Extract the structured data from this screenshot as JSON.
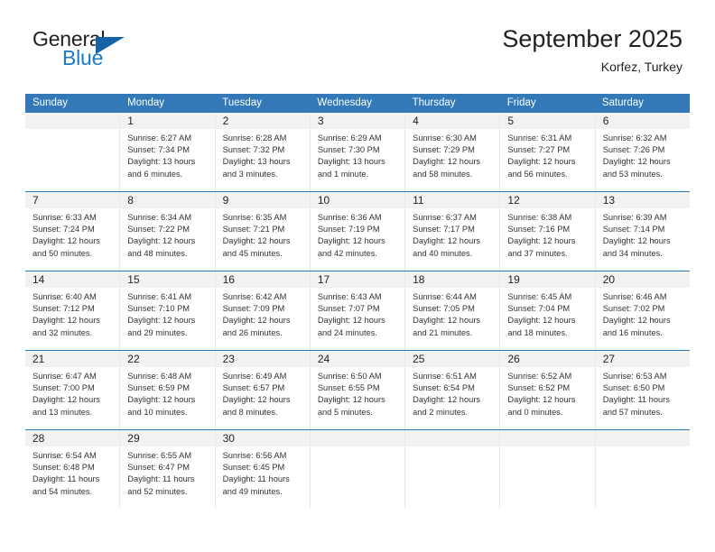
{
  "brand": {
    "name_top": "General",
    "name_bottom": "Blue",
    "accent_color": "#1464a5",
    "text_color": "#1a7ac4"
  },
  "header": {
    "month_title": "September 2025",
    "location": "Korfez, Turkey"
  },
  "calendar": {
    "header_bg": "#3379b8",
    "daynumber_bg": "#f2f2f2",
    "weekday_headers": [
      "Sunday",
      "Monday",
      "Tuesday",
      "Wednesday",
      "Thursday",
      "Friday",
      "Saturday"
    ],
    "weeks": [
      [
        {
          "empty": true,
          "day": "",
          "sunrise": "",
          "sunset": "",
          "daylight1": "",
          "daylight2": ""
        },
        {
          "empty": false,
          "day": "1",
          "sunrise": "Sunrise: 6:27 AM",
          "sunset": "Sunset: 7:34 PM",
          "daylight1": "Daylight: 13 hours",
          "daylight2": "and 6 minutes."
        },
        {
          "empty": false,
          "day": "2",
          "sunrise": "Sunrise: 6:28 AM",
          "sunset": "Sunset: 7:32 PM",
          "daylight1": "Daylight: 13 hours",
          "daylight2": "and 3 minutes."
        },
        {
          "empty": false,
          "day": "3",
          "sunrise": "Sunrise: 6:29 AM",
          "sunset": "Sunset: 7:30 PM",
          "daylight1": "Daylight: 13 hours",
          "daylight2": "and 1 minute."
        },
        {
          "empty": false,
          "day": "4",
          "sunrise": "Sunrise: 6:30 AM",
          "sunset": "Sunset: 7:29 PM",
          "daylight1": "Daylight: 12 hours",
          "daylight2": "and 58 minutes."
        },
        {
          "empty": false,
          "day": "5",
          "sunrise": "Sunrise: 6:31 AM",
          "sunset": "Sunset: 7:27 PM",
          "daylight1": "Daylight: 12 hours",
          "daylight2": "and 56 minutes."
        },
        {
          "empty": false,
          "day": "6",
          "sunrise": "Sunrise: 6:32 AM",
          "sunset": "Sunset: 7:26 PM",
          "daylight1": "Daylight: 12 hours",
          "daylight2": "and 53 minutes."
        }
      ],
      [
        {
          "empty": false,
          "day": "7",
          "sunrise": "Sunrise: 6:33 AM",
          "sunset": "Sunset: 7:24 PM",
          "daylight1": "Daylight: 12 hours",
          "daylight2": "and 50 minutes."
        },
        {
          "empty": false,
          "day": "8",
          "sunrise": "Sunrise: 6:34 AM",
          "sunset": "Sunset: 7:22 PM",
          "daylight1": "Daylight: 12 hours",
          "daylight2": "and 48 minutes."
        },
        {
          "empty": false,
          "day": "9",
          "sunrise": "Sunrise: 6:35 AM",
          "sunset": "Sunset: 7:21 PM",
          "daylight1": "Daylight: 12 hours",
          "daylight2": "and 45 minutes."
        },
        {
          "empty": false,
          "day": "10",
          "sunrise": "Sunrise: 6:36 AM",
          "sunset": "Sunset: 7:19 PM",
          "daylight1": "Daylight: 12 hours",
          "daylight2": "and 42 minutes."
        },
        {
          "empty": false,
          "day": "11",
          "sunrise": "Sunrise: 6:37 AM",
          "sunset": "Sunset: 7:17 PM",
          "daylight1": "Daylight: 12 hours",
          "daylight2": "and 40 minutes."
        },
        {
          "empty": false,
          "day": "12",
          "sunrise": "Sunrise: 6:38 AM",
          "sunset": "Sunset: 7:16 PM",
          "daylight1": "Daylight: 12 hours",
          "daylight2": "and 37 minutes."
        },
        {
          "empty": false,
          "day": "13",
          "sunrise": "Sunrise: 6:39 AM",
          "sunset": "Sunset: 7:14 PM",
          "daylight1": "Daylight: 12 hours",
          "daylight2": "and 34 minutes."
        }
      ],
      [
        {
          "empty": false,
          "day": "14",
          "sunrise": "Sunrise: 6:40 AM",
          "sunset": "Sunset: 7:12 PM",
          "daylight1": "Daylight: 12 hours",
          "daylight2": "and 32 minutes."
        },
        {
          "empty": false,
          "day": "15",
          "sunrise": "Sunrise: 6:41 AM",
          "sunset": "Sunset: 7:10 PM",
          "daylight1": "Daylight: 12 hours",
          "daylight2": "and 29 minutes."
        },
        {
          "empty": false,
          "day": "16",
          "sunrise": "Sunrise: 6:42 AM",
          "sunset": "Sunset: 7:09 PM",
          "daylight1": "Daylight: 12 hours",
          "daylight2": "and 26 minutes."
        },
        {
          "empty": false,
          "day": "17",
          "sunrise": "Sunrise: 6:43 AM",
          "sunset": "Sunset: 7:07 PM",
          "daylight1": "Daylight: 12 hours",
          "daylight2": "and 24 minutes."
        },
        {
          "empty": false,
          "day": "18",
          "sunrise": "Sunrise: 6:44 AM",
          "sunset": "Sunset: 7:05 PM",
          "daylight1": "Daylight: 12 hours",
          "daylight2": "and 21 minutes."
        },
        {
          "empty": false,
          "day": "19",
          "sunrise": "Sunrise: 6:45 AM",
          "sunset": "Sunset: 7:04 PM",
          "daylight1": "Daylight: 12 hours",
          "daylight2": "and 18 minutes."
        },
        {
          "empty": false,
          "day": "20",
          "sunrise": "Sunrise: 6:46 AM",
          "sunset": "Sunset: 7:02 PM",
          "daylight1": "Daylight: 12 hours",
          "daylight2": "and 16 minutes."
        }
      ],
      [
        {
          "empty": false,
          "day": "21",
          "sunrise": "Sunrise: 6:47 AM",
          "sunset": "Sunset: 7:00 PM",
          "daylight1": "Daylight: 12 hours",
          "daylight2": "and 13 minutes."
        },
        {
          "empty": false,
          "day": "22",
          "sunrise": "Sunrise: 6:48 AM",
          "sunset": "Sunset: 6:59 PM",
          "daylight1": "Daylight: 12 hours",
          "daylight2": "and 10 minutes."
        },
        {
          "empty": false,
          "day": "23",
          "sunrise": "Sunrise: 6:49 AM",
          "sunset": "Sunset: 6:57 PM",
          "daylight1": "Daylight: 12 hours",
          "daylight2": "and 8 minutes."
        },
        {
          "empty": false,
          "day": "24",
          "sunrise": "Sunrise: 6:50 AM",
          "sunset": "Sunset: 6:55 PM",
          "daylight1": "Daylight: 12 hours",
          "daylight2": "and 5 minutes."
        },
        {
          "empty": false,
          "day": "25",
          "sunrise": "Sunrise: 6:51 AM",
          "sunset": "Sunset: 6:54 PM",
          "daylight1": "Daylight: 12 hours",
          "daylight2": "and 2 minutes."
        },
        {
          "empty": false,
          "day": "26",
          "sunrise": "Sunrise: 6:52 AM",
          "sunset": "Sunset: 6:52 PM",
          "daylight1": "Daylight: 12 hours",
          "daylight2": "and 0 minutes."
        },
        {
          "empty": false,
          "day": "27",
          "sunrise": "Sunrise: 6:53 AM",
          "sunset": "Sunset: 6:50 PM",
          "daylight1": "Daylight: 11 hours",
          "daylight2": "and 57 minutes."
        }
      ],
      [
        {
          "empty": false,
          "day": "28",
          "sunrise": "Sunrise: 6:54 AM",
          "sunset": "Sunset: 6:48 PM",
          "daylight1": "Daylight: 11 hours",
          "daylight2": "and 54 minutes."
        },
        {
          "empty": false,
          "day": "29",
          "sunrise": "Sunrise: 6:55 AM",
          "sunset": "Sunset: 6:47 PM",
          "daylight1": "Daylight: 11 hours",
          "daylight2": "and 52 minutes."
        },
        {
          "empty": false,
          "day": "30",
          "sunrise": "Sunrise: 6:56 AM",
          "sunset": "Sunset: 6:45 PM",
          "daylight1": "Daylight: 11 hours",
          "daylight2": "and 49 minutes."
        },
        {
          "empty": true,
          "day": "",
          "sunrise": "",
          "sunset": "",
          "daylight1": "",
          "daylight2": ""
        },
        {
          "empty": true,
          "day": "",
          "sunrise": "",
          "sunset": "",
          "daylight1": "",
          "daylight2": ""
        },
        {
          "empty": true,
          "day": "",
          "sunrise": "",
          "sunset": "",
          "daylight1": "",
          "daylight2": ""
        },
        {
          "empty": true,
          "day": "",
          "sunrise": "",
          "sunset": "",
          "daylight1": "",
          "daylight2": ""
        }
      ]
    ]
  }
}
